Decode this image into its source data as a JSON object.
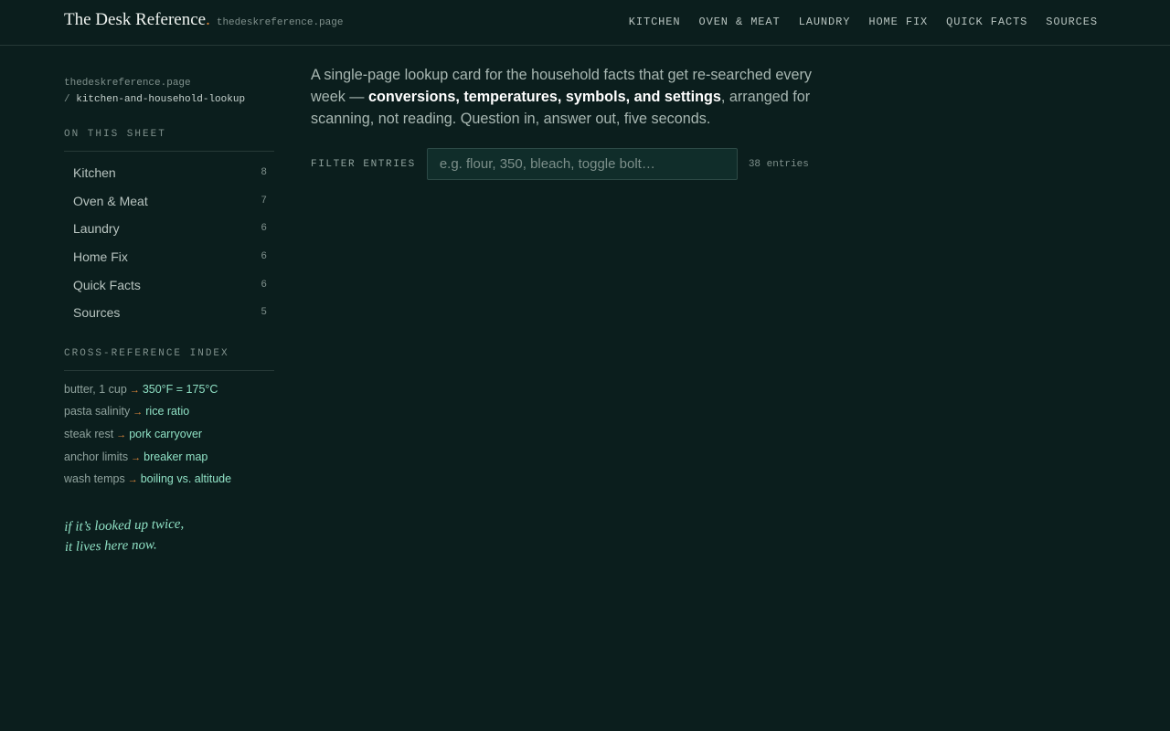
{
  "brand": {
    "name": "The Desk Reference",
    "dot": ".",
    "domain": "thedeskreference.page"
  },
  "nav": [
    "KITCHEN",
    "OVEN & MEAT",
    "LAUNDRY",
    "HOME FIX",
    "QUICK FACTS",
    "SOURCES"
  ],
  "sidebar": {
    "path_root": "thedeskreference.page",
    "path_sep": "/",
    "path_slug": "kitchen-and-household-lookup",
    "toc_heading": "ON THIS SHEET",
    "toc": [
      {
        "label": "Kitchen",
        "count": "8"
      },
      {
        "label": "Oven & Meat",
        "count": "7"
      },
      {
        "label": "Laundry",
        "count": "6"
      },
      {
        "label": "Home Fix",
        "count": "6"
      },
      {
        "label": "Quick Facts",
        "count": "6"
      },
      {
        "label": "Sources",
        "count": "5"
      }
    ],
    "xref_heading": "CROSS-REFERENCE INDEX",
    "xref_arrow": "→",
    "xref": [
      {
        "from": "butter, 1 cup",
        "to": "350°F = 175°C"
      },
      {
        "from": "pasta salinity",
        "to": "rice ratio"
      },
      {
        "from": "steak rest",
        "to": "pork carryover"
      },
      {
        "from": "anchor limits",
        "to": "breaker map"
      },
      {
        "from": "wash temps",
        "to": "boiling vs. altitude"
      }
    ],
    "note_line1": "if it’s looked up twice,",
    "note_line2": "it lives here now."
  },
  "intro": {
    "before": "A single-page lookup card for the household facts that get re-searched every week — ",
    "strong": "conversions, temperatures, symbols, and settings",
    "after": ", arranged for scanning, not reading. Question in, answer out, five seconds."
  },
  "filter": {
    "label": "FILTER ENTRIES",
    "placeholder": "e.g. flour, 350, bleach, toggle bolt…",
    "value": "",
    "count": "38 entries"
  },
  "colors": {
    "background": "#0b1e1d",
    "accent_orange": "#e0883a",
    "accent_mint": "#8fe0c4"
  }
}
